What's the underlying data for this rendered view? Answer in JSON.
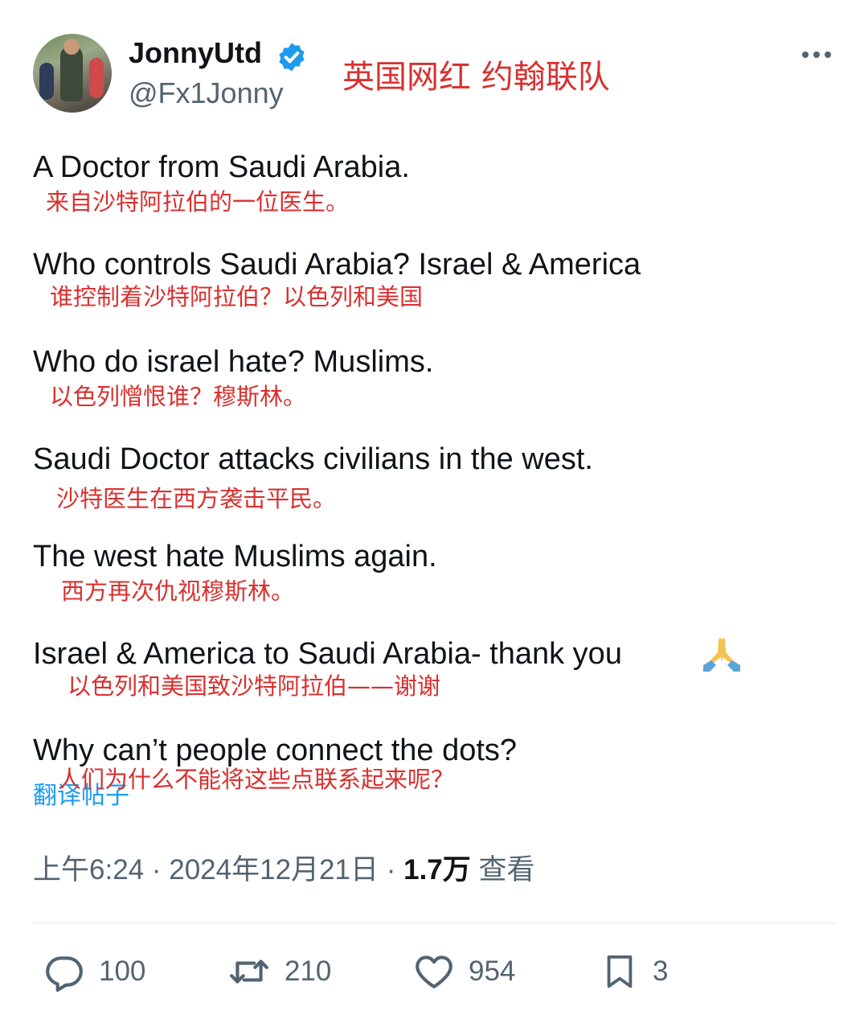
{
  "header": {
    "display_name": "JonnyUtd",
    "handle": "@Fx1Jonny",
    "annotation": "英国网红 约翰联队",
    "verified_color": "#1d9bf0",
    "more_icon": "more-horizontal-icon"
  },
  "tweet": {
    "lines": [
      {
        "en": "A Doctor from Saudi Arabia.",
        "cn": "来自沙特阿拉伯的一位医生。"
      },
      {
        "en": "Who controls Saudi Arabia? Israel & America",
        "cn": "谁控制着沙特阿拉伯？以色列和美国"
      },
      {
        "en": "Who do israel hate? Muslims.",
        "cn": "以色列憎恨谁？穆斯林。"
      },
      {
        "en": "Saudi Doctor attacks civilians in the west.",
        "cn": "沙特医生在西方袭击平民。"
      },
      {
        "en": "The west hate Muslims again.",
        "cn": "西方再次仇视穆斯林。"
      },
      {
        "en": "Israel & America to Saudi Arabia- thank you",
        "cn": "以色列和美国致沙特阿拉伯——谢谢",
        "emoji": "🙏"
      },
      {
        "en": "Why can’t people connect the dots?",
        "cn": "人们为什么不能将这些点联系起来呢？"
      }
    ],
    "translate_label": "翻译帖子"
  },
  "meta": {
    "time": "上午6:24",
    "date": "2024年12月21日",
    "views_count": "1.7万",
    "views_label": "查看"
  },
  "actions": {
    "replies": "100",
    "reposts": "210",
    "likes": "954",
    "bookmarks": "3"
  },
  "colors": {
    "text": "#0f1419",
    "secondary": "#536471",
    "annotation_red": "#d8312f",
    "link_blue": "#1d9bf0"
  }
}
